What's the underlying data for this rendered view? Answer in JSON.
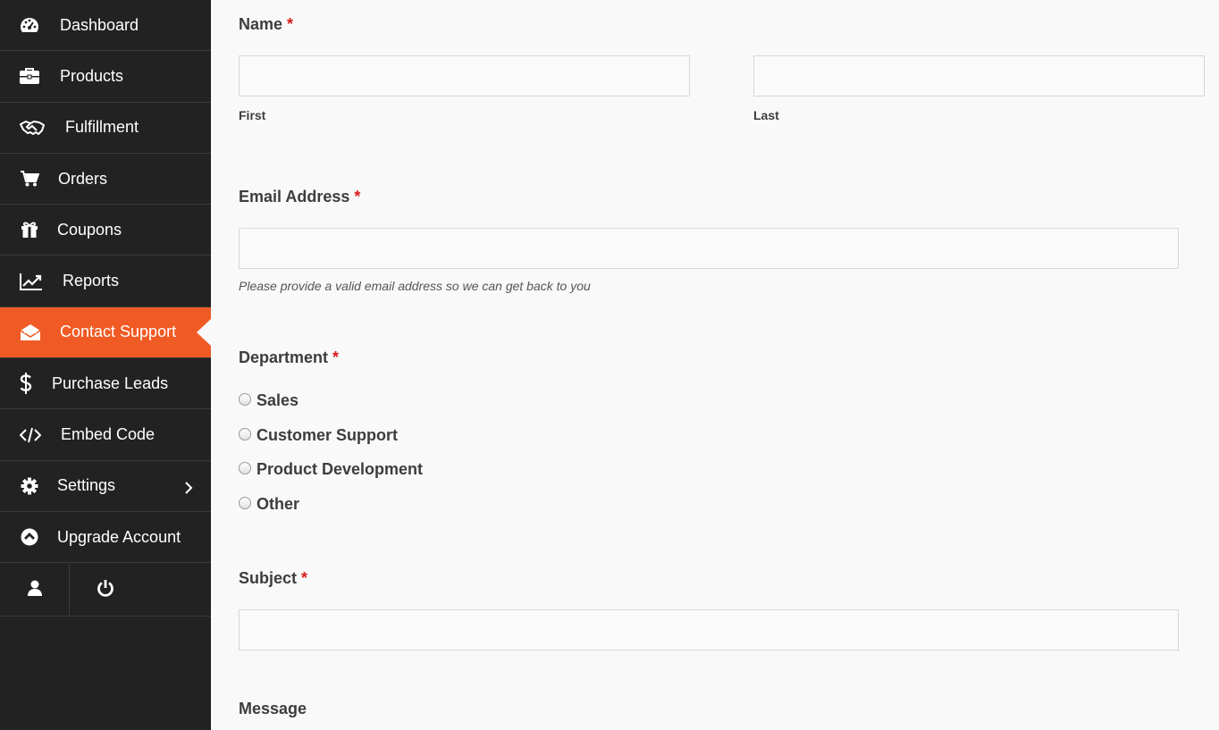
{
  "sidebar": {
    "items": [
      {
        "label": "Dashboard",
        "icon": "dashboard-icon",
        "active": false
      },
      {
        "label": "Products",
        "icon": "briefcase-icon",
        "active": false
      },
      {
        "label": "Fulfillment",
        "icon": "handshake-icon",
        "active": false
      },
      {
        "label": "Orders",
        "icon": "cart-icon",
        "active": false
      },
      {
        "label": "Coupons",
        "icon": "gift-icon",
        "active": false
      },
      {
        "label": "Reports",
        "icon": "line-chart-icon",
        "active": false
      },
      {
        "label": "Contact Support",
        "icon": "envelope-open-icon",
        "active": true
      },
      {
        "label": "Purchase Leads",
        "icon": "dollar-icon",
        "active": false
      },
      {
        "label": "Embed Code",
        "icon": "code-icon",
        "active": false
      },
      {
        "label": "Settings",
        "icon": "gear-icon",
        "active": false
      },
      {
        "label": "Upgrade Account",
        "icon": "chevron-up-circle-icon",
        "active": false
      }
    ],
    "bottom": [
      "user-icon",
      "power-icon"
    ]
  },
  "colors": {
    "sidebar_bg": "#222222",
    "active_bg": "#f05a24",
    "required": "#d91c1c"
  },
  "form": {
    "name": {
      "label": "Name",
      "required_mark": "*",
      "first_label": "First",
      "last_label": "Last",
      "first_value": "",
      "last_value": ""
    },
    "email": {
      "label": "Email Address",
      "required_mark": "*",
      "value": "",
      "help": "Please provide a valid email address so we can get back to you"
    },
    "department": {
      "label": "Department",
      "required_mark": "*",
      "options": [
        "Sales",
        "Customer Support",
        "Product Development",
        "Other"
      ]
    },
    "subject": {
      "label": "Subject",
      "required_mark": "*",
      "value": ""
    },
    "message": {
      "label": "Message"
    }
  }
}
